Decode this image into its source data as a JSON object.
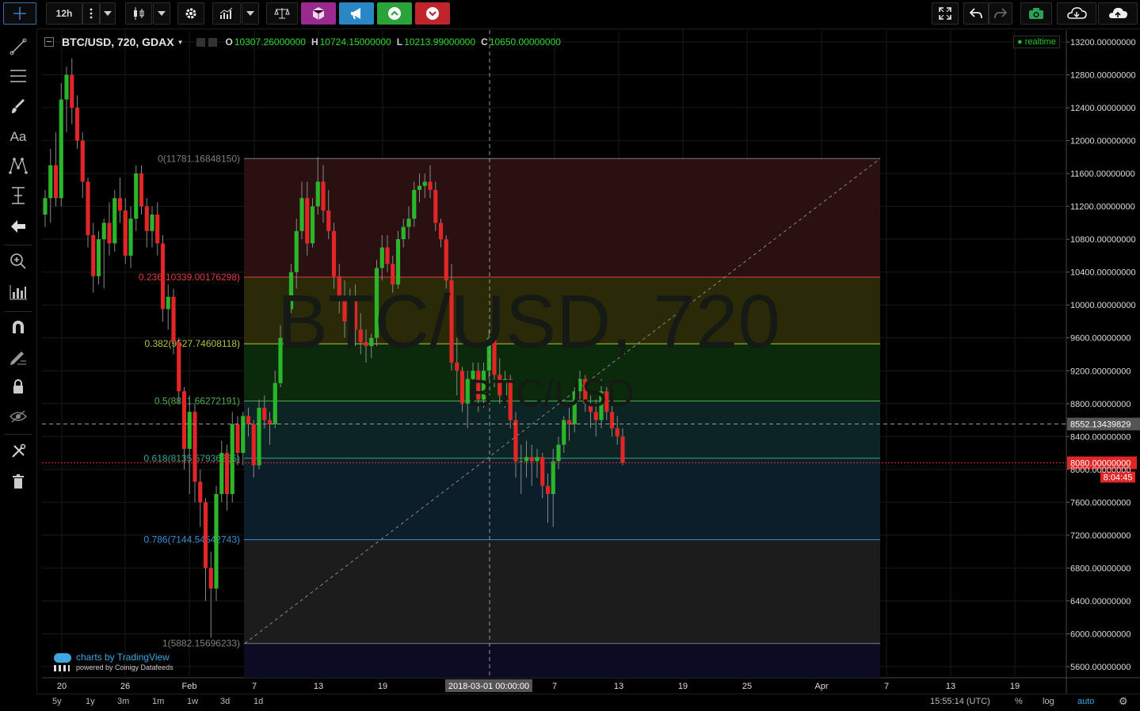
{
  "toolbar": {
    "interval": "12h",
    "colors": {
      "indicator_btn": "#9a2a8f",
      "broadcast_btn": "#2a86c4",
      "buy_btn": "#2aa33a",
      "sell_btn": "#c1252c"
    }
  },
  "legend": {
    "title": "BTC/USD, 720, GDAX",
    "o_label": "O",
    "o_value": "10307.26000000",
    "h_label": "H",
    "h_value": "10724.15000000",
    "l_label": "L",
    "l_value": "10213.99000000",
    "c_label": "C",
    "c_value": "10650.00000000",
    "realtime": "realtime"
  },
  "watermark": {
    "main": "BTC/USD, 720",
    "sub": "BTC/USD"
  },
  "branding": {
    "line1": "charts by TradingView",
    "line2": "powered by Coinigy Datafeeds"
  },
  "fib_labels": [
    "0(11781.16848150)",
    "0.236(10339.00176298)",
    "0.382(9527.74608118)",
    "0.5(8831.66272191)",
    "0.618(8135.57936265)",
    "0.786(7144.54542743)",
    "1(5882.15696233)"
  ],
  "crosshair": {
    "time_label": "2018-03-01 00:00:00",
    "price_label": "8552.13439829"
  },
  "last_price": {
    "label": "8080.00000000",
    "countdown": "8:04:45"
  },
  "bottom": {
    "ranges": [
      "5y",
      "1y",
      "3m",
      "1m",
      "1w",
      "3d",
      "1d"
    ],
    "clock": "15:55:14 (UTC)",
    "percent": "%",
    "log": "log",
    "auto": "auto"
  },
  "chart_data": {
    "type": "candlestick",
    "symbol": "BTC/USD",
    "interval": "720",
    "exchange": "GDAX",
    "y_axis": {
      "ticks": [
        13200,
        12800,
        12400,
        12000,
        11600,
        11200,
        10800,
        10400,
        10000,
        9600,
        9200,
        8800,
        8400,
        8000,
        7600,
        7200,
        6800,
        6400,
        6000,
        5600
      ],
      "min": 5500,
      "max": 13250,
      "log": false
    },
    "x_ticks": [
      "20",
      "26",
      "Feb",
      "7",
      "13",
      "19",
      "7",
      "13",
      "19",
      "25",
      "Apr",
      "7",
      "13",
      "19"
    ],
    "fibonacci": [
      {
        "level": 0,
        "price": 11781.1684815,
        "color": "#7f7f7f",
        "fill": "#2a1010"
      },
      {
        "level": 0.236,
        "price": 10339.00176298,
        "color": "#e03b3b",
        "fill": "#2a2a08"
      },
      {
        "level": 0.382,
        "price": 9527.74608118,
        "color": "#b7c23a",
        "fill": "#0b2a0b"
      },
      {
        "level": 0.5,
        "price": 8831.66272191,
        "color": "#4caf50",
        "fill": "#0c2424"
      },
      {
        "level": 0.618,
        "price": 8135.57936265,
        "color": "#3aa48f",
        "fill": "#0c1e2a"
      },
      {
        "level": 0.786,
        "price": 7144.54542743,
        "color": "#3a8fd0",
        "fill": "#1c1c1c"
      },
      {
        "level": 1,
        "price": 5882.15696233,
        "color": "#7f7f7f",
        "fill": "#0b0b24"
      }
    ],
    "candles": [
      [
        11100,
        11400,
        10950,
        11300
      ],
      [
        11300,
        11900,
        11000,
        11700
      ],
      [
        11700,
        12100,
        11200,
        11300
      ],
      [
        11300,
        12700,
        11200,
        12500
      ],
      [
        12500,
        12900,
        12100,
        12800
      ],
      [
        12800,
        13000,
        12200,
        12400
      ],
      [
        12400,
        12550,
        11900,
        12000
      ],
      [
        12000,
        12100,
        11300,
        11500
      ],
      [
        11500,
        11550,
        10700,
        10850
      ],
      [
        10850,
        11000,
        10150,
        10350
      ],
      [
        10350,
        10900,
        10250,
        10800
      ],
      [
        10800,
        11050,
        10200,
        11000
      ],
      [
        11000,
        11250,
        10600,
        10750
      ],
      [
        10750,
        11400,
        10650,
        11300
      ],
      [
        11300,
        11550,
        11000,
        11150
      ],
      [
        11150,
        11300,
        10500,
        10600
      ],
      [
        10600,
        11200,
        10450,
        11050
      ],
      [
        11050,
        11700,
        10900,
        11600
      ],
      [
        11600,
        11700,
        11100,
        11200
      ],
      [
        11200,
        11300,
        10700,
        10900
      ],
      [
        10900,
        11200,
        10700,
        11100
      ],
      [
        11100,
        11250,
        10600,
        10750
      ],
      [
        10750,
        10850,
        9800,
        9950
      ],
      [
        9950,
        10250,
        9700,
        10100
      ],
      [
        10100,
        10200,
        9400,
        9550
      ],
      [
        9550,
        9600,
        8800,
        8950
      ],
      [
        8950,
        9000,
        8000,
        8250
      ],
      [
        8250,
        8900,
        7700,
        8700
      ],
      [
        8700,
        8800,
        7600,
        7850
      ],
      [
        7850,
        8000,
        7300,
        7600
      ],
      [
        7600,
        7650,
        6400,
        6800
      ],
      [
        6800,
        7000,
        5950,
        6550
      ],
      [
        6550,
        7800,
        6400,
        7700
      ],
      [
        7700,
        8350,
        7600,
        8200
      ],
      [
        8200,
        8300,
        7500,
        7700
      ],
      [
        7700,
        8700,
        7600,
        8550
      ],
      [
        8550,
        8650,
        8050,
        8200
      ],
      [
        8200,
        8700,
        8050,
        8650
      ],
      [
        8650,
        8750,
        8400,
        8550
      ],
      [
        8550,
        8600,
        7900,
        8050
      ],
      [
        8050,
        8850,
        8000,
        8750
      ],
      [
        8750,
        8900,
        8500,
        8600
      ],
      [
        8600,
        8700,
        8300,
        8550
      ],
      [
        8550,
        9200,
        8500,
        9050
      ],
      [
        9050,
        9750,
        9000,
        9600
      ],
      [
        9600,
        10100,
        9550,
        9950
      ],
      [
        9950,
        10500,
        9900,
        10400
      ],
      [
        10400,
        11050,
        10200,
        10900
      ],
      [
        10900,
        11500,
        10800,
        11300
      ],
      [
        11300,
        11500,
        10600,
        10750
      ],
      [
        10750,
        11300,
        10700,
        11200
      ],
      [
        11200,
        11800,
        11100,
        11500
      ],
      [
        11500,
        11700,
        11000,
        11150
      ],
      [
        11150,
        11400,
        10800,
        10900
      ],
      [
        10900,
        11000,
        10200,
        10350
      ],
      [
        10350,
        10500,
        9900,
        10100
      ],
      [
        10100,
        10300,
        9600,
        9800
      ],
      [
        9800,
        10200,
        9600,
        10100
      ],
      [
        10100,
        10250,
        9500,
        9700
      ],
      [
        9700,
        9900,
        9400,
        9550
      ],
      [
        9550,
        9700,
        9300,
        9500
      ],
      [
        9500,
        9650,
        9350,
        9600
      ],
      [
        9600,
        10550,
        9500,
        10450
      ],
      [
        10450,
        10850,
        10300,
        10700
      ],
      [
        10700,
        10850,
        10400,
        10500
      ],
      [
        10500,
        10600,
        10150,
        10250
      ],
      [
        10250,
        10900,
        10200,
        10800
      ],
      [
        10800,
        11050,
        10700,
        10950
      ],
      [
        10950,
        11200,
        10800,
        11050
      ],
      [
        11050,
        11500,
        10950,
        11400
      ],
      [
        11400,
        11600,
        11250,
        11450
      ],
      [
        11450,
        11600,
        11300,
        11500
      ],
      [
        11500,
        11700,
        11300,
        11400
      ],
      [
        11400,
        11500,
        10900,
        11000
      ],
      [
        11000,
        11050,
        10700,
        10800
      ],
      [
        10800,
        10850,
        10200,
        10300
      ],
      [
        10300,
        10500,
        9200,
        9300
      ],
      [
        9300,
        9600,
        8900,
        9200
      ],
      [
        9200,
        9250,
        8700,
        8800
      ],
      [
        8800,
        9200,
        8500,
        9100
      ],
      [
        9100,
        9300,
        8900,
        9200
      ],
      [
        9200,
        9300,
        8700,
        8850
      ],
      [
        8850,
        9300,
        8750,
        9200
      ],
      [
        9200,
        9700,
        9100,
        9600
      ],
      [
        9600,
        9750,
        9000,
        9150
      ],
      [
        9150,
        9350,
        8800,
        8900
      ],
      [
        8900,
        9200,
        8750,
        9100
      ],
      [
        9100,
        9150,
        8500,
        8600
      ],
      [
        8600,
        8700,
        7900,
        8100
      ],
      [
        8100,
        8300,
        7700,
        8100
      ],
      [
        8100,
        8350,
        7900,
        8150
      ],
      [
        8150,
        8300,
        7800,
        8100
      ],
      [
        8100,
        8250,
        7900,
        8150
      ],
      [
        8150,
        8200,
        7650,
        7800
      ],
      [
        7800,
        7950,
        7350,
        7700
      ],
      [
        7700,
        8250,
        7300,
        8100
      ],
      [
        8100,
        8400,
        8000,
        8300
      ],
      [
        8300,
        8650,
        8200,
        8600
      ],
      [
        8600,
        8750,
        8350,
        8550
      ],
      [
        8550,
        9000,
        8450,
        8950
      ],
      [
        8950,
        9200,
        8850,
        9100
      ],
      [
        9100,
        9150,
        8700,
        8800
      ],
      [
        8800,
        8900,
        8500,
        8700
      ],
      [
        8700,
        8850,
        8400,
        8600
      ],
      [
        8600,
        9100,
        8500,
        8950
      ],
      [
        8950,
        9000,
        8600,
        8700
      ],
      [
        8700,
        8900,
        8400,
        8500
      ],
      [
        8500,
        8650,
        8300,
        8400
      ],
      [
        8400,
        8500,
        8050,
        8080
      ]
    ]
  }
}
